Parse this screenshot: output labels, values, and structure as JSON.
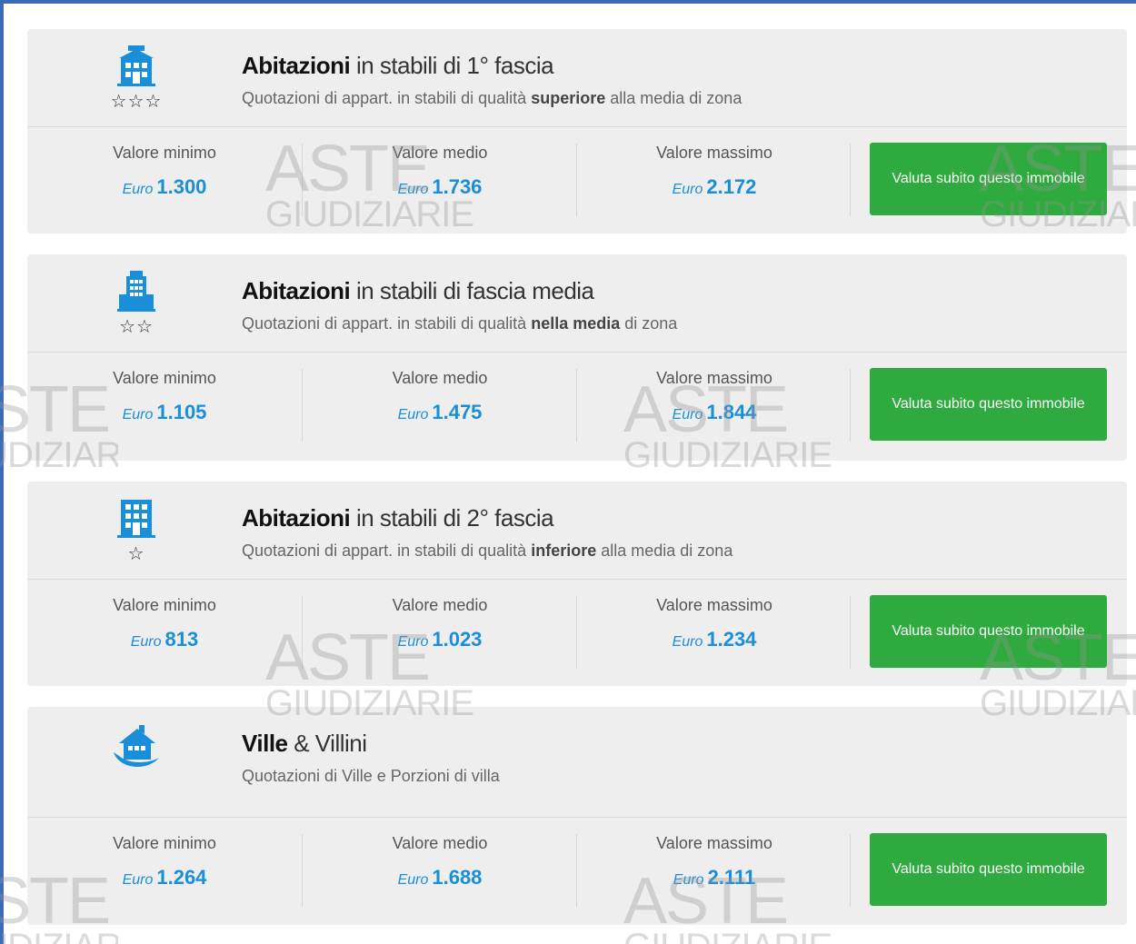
{
  "labels": {
    "min": "Valore minimo",
    "mid": "Valore medio",
    "max": "Valore massimo",
    "currency": "Euro",
    "cta": "Valuta subito questo immobile"
  },
  "watermark": {
    "top": "ASTE",
    "bottom": "GIUDIZIARIE"
  },
  "cards": [
    {
      "title_bold": "Abitazioni",
      "title_rest": " in stabili di 1° fascia",
      "sub_pre": "Quotazioni di appart. in stabili di qualità ",
      "sub_bold": "superiore",
      "sub_post": " alla media di zona",
      "stars": "☆☆☆",
      "min": "1.300",
      "mid": "1.736",
      "max": "2.172",
      "icon": "building-first-class-icon"
    },
    {
      "title_bold": "Abitazioni",
      "title_rest": " in stabili di fascia media",
      "sub_pre": "Quotazioni di appart. in stabili di qualità ",
      "sub_bold": "nella media",
      "sub_post": " di zona",
      "stars": "☆☆",
      "min": "1.105",
      "mid": "1.475",
      "max": "1.844",
      "icon": "building-medium-class-icon"
    },
    {
      "title_bold": "Abitazioni",
      "title_rest": " in stabili di 2° fascia",
      "sub_pre": "Quotazioni di appart. in stabili di qualità ",
      "sub_bold": "inferiore",
      "sub_post": " alla media di zona",
      "stars": "☆",
      "min": "813",
      "mid": "1.023",
      "max": "1.234",
      "icon": "building-second-class-icon"
    },
    {
      "title_bold": "Ville",
      "title_rest": " & Villini",
      "sub_pre": "Quotazioni di Ville e Porzioni di villa",
      "sub_bold": "",
      "sub_post": "",
      "stars": "",
      "min": "1.264",
      "mid": "1.688",
      "max": "2.111",
      "icon": "villa-icon"
    }
  ],
  "colors": {
    "accent_blue": "#1a8fd9",
    "button_green": "#2eaa3e",
    "card_bg": "#eeeeee",
    "frame_blue": "#3d6bb8"
  }
}
